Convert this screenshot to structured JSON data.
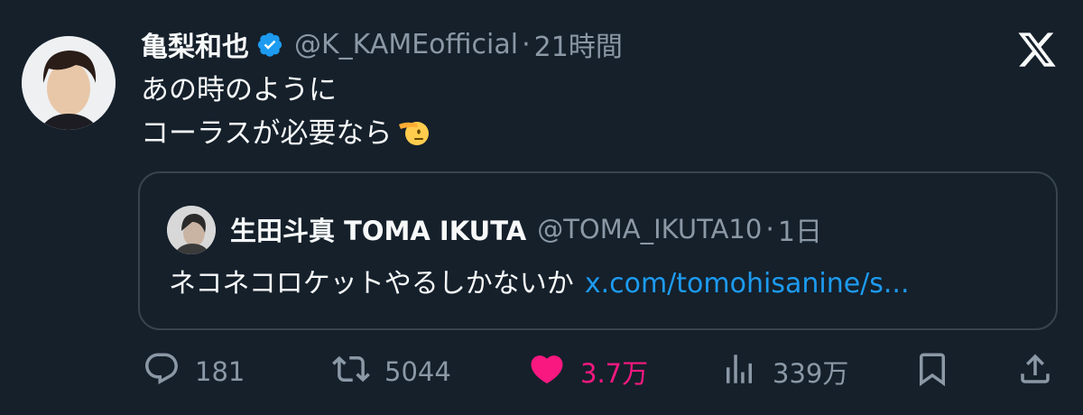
{
  "tweet": {
    "author_name": "亀梨和也",
    "handle": "@K_KAMEofficial",
    "separator": "·",
    "time": "21時間",
    "text_line1": "あの時のように",
    "text_line2": "コーラスが必要なら"
  },
  "quote": {
    "author_name": "生田斗真 TOMA IKUTA",
    "handle": "@TOMA_IKUTA10",
    "separator": "·",
    "time": "1日",
    "text": "ネコネコロケットやるしかないか",
    "link": "x.com/tomohisanine/s..."
  },
  "actions": {
    "replies": "181",
    "retweets": "5044",
    "likes": "3.7万",
    "views": "339万"
  },
  "colors": {
    "background": "#15202b",
    "secondary_text": "#8b98a5",
    "link": "#1d9bf0",
    "like": "#f91880",
    "verified": "#1d9bf0",
    "border": "#38444d"
  },
  "icons": {
    "verified": "verified-badge-icon",
    "brand": "x-logo-icon",
    "emoji": "saluting-face-emoji",
    "reply": "reply-icon",
    "retweet": "retweet-icon",
    "like": "heart-icon",
    "views": "views-chart-icon",
    "bookmark": "bookmark-icon",
    "share": "share-icon"
  }
}
